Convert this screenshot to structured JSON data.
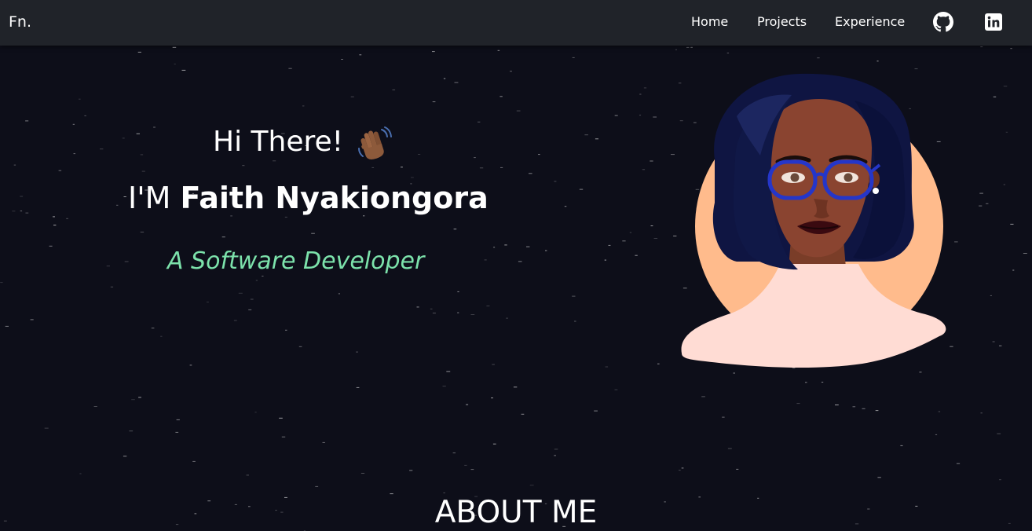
{
  "navbar": {
    "brand": "Fn.",
    "links": [
      {
        "label": "Home"
      },
      {
        "label": "Projects"
      },
      {
        "label": "Experience"
      }
    ],
    "icons": [
      "github-icon",
      "linkedin-icon"
    ]
  },
  "hero": {
    "greeting": "Hi There!",
    "greeting_icon": "waving-hand-icon",
    "name_prefix": "I'M ",
    "name": "Faith Nyakiongora",
    "role": "A Software Developer",
    "avatar_icon": "developer-avatar-illustration"
  },
  "about": {
    "heading": "ABOUT ME"
  },
  "colors": {
    "background": "#0d0e19",
    "navbar": "#202329",
    "accent": "#7ce2ab",
    "text": "#ffffff"
  }
}
